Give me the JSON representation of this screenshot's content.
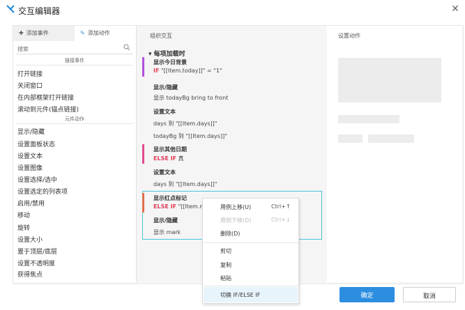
{
  "window": {
    "title": "交互编辑器",
    "close_glyph": "✕"
  },
  "left": {
    "tabs": [
      {
        "label": "添加事件",
        "icon": "add-event-icon"
      },
      {
        "label": "添加动作",
        "icon": "add-action-icon"
      }
    ],
    "search_placeholder": "搜索",
    "link_section": "链接事件",
    "link_items": [
      "打开链接",
      "关闭窗口",
      "在内部框架打开链接",
      "滚动到元件(锚点链接)"
    ],
    "widget_section": "元件动作",
    "widget_items": [
      "显示/隐藏",
      "设置面板状态",
      "设置文本",
      "设置图像",
      "设置选择/选中",
      "设置选定的列表项",
      "启用/禁用",
      "移动",
      "旋转",
      "设置大小",
      "置于顶层/底层",
      "设置不透明度",
      "获得焦点"
    ]
  },
  "middle": {
    "title": "组织交互",
    "event": "▾ 每项加载时",
    "cases": [
      {
        "title": "显示今日背景",
        "condition_kw": "IF",
        "condition": "\"[[Item.today]]\" = \"1\"",
        "bar_color": "#b34fe0"
      },
      {
        "action_title": "显示/隐藏",
        "action_line": "显示 todayBg  bring to front"
      },
      {
        "action_title": "设置文本",
        "action_line": "days 到 \"[[Item.days]]\"",
        "action_line2": "todayBg 到 \"[[Item.days]]\""
      },
      {
        "title": "显示其他日期",
        "condition_kw": "ELSE IF",
        "condition": "真",
        "bar_color": "#e24a8c"
      },
      {
        "action_title": "设置文本",
        "action_line": "days 到 \"[[Item.days]]\""
      },
      {
        "title": "显示红点标记",
        "condition_kw": "ELSE IF",
        "condition": "\"[[Item.m",
        "bar_color": "#e0704a"
      },
      {
        "action_title": "显示/隐藏",
        "action_line": "显示 mark"
      }
    ]
  },
  "right": {
    "title": "设置动作"
  },
  "context_menu": {
    "items": [
      {
        "label": "用例上移(U)",
        "shortcut": "Ctrl+↑",
        "disabled": false
      },
      {
        "label": "用例下移(D)",
        "shortcut": "Ctrl+↓",
        "disabled": true
      },
      {
        "label": "删除(D)",
        "shortcut": "",
        "disabled": false
      },
      {
        "label": "剪切",
        "shortcut": "",
        "disabled": false
      },
      {
        "label": "复制",
        "shortcut": "",
        "disabled": false
      },
      {
        "label": "粘贴",
        "shortcut": "",
        "disabled": false
      },
      {
        "label": "切换 IF/ELSE IF",
        "shortcut": "",
        "disabled": false
      }
    ]
  },
  "buttons": {
    "ok": "确定",
    "cancel": "取消"
  },
  "colors": {
    "accent": "#2d8ee0",
    "selection_border": "#4cc3d4",
    "keyword": "#e0405a"
  }
}
